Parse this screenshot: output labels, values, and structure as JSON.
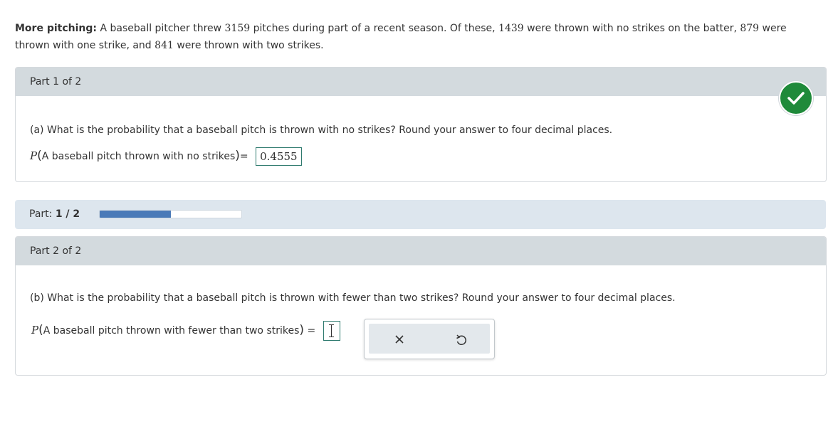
{
  "intro": {
    "label": "More pitching:",
    "text1": "A baseball pitcher threw",
    "total": "3159",
    "text2": "pitches during part of a recent season. Of these,",
    "no_strikes": "1439",
    "text3": "were thrown with no strikes on the batter,",
    "one_strike": "879",
    "text4": "were thrown with one strike, and",
    "two_strikes": "841",
    "text5": "were thrown with two strikes."
  },
  "part1": {
    "header": "Part 1 of 2",
    "question": "(a) What is the probability that a baseball pitch is thrown with no strikes? Round your answer to four decimal places.",
    "p_symbol": "P",
    "event": "A baseball pitch thrown with no strikes",
    "equals": "=",
    "answer": "0.4555",
    "status": "correct"
  },
  "progress": {
    "label": "Part:",
    "value": "1 / 2",
    "fraction": 0.5,
    "fill_color": "#4a7ab8"
  },
  "part2": {
    "header": "Part 2 of 2",
    "question": "(b) What is the probability that a baseball pitch is thrown with fewer than two strikes? Round your answer to four decimal places.",
    "p_symbol": "P",
    "event": "A baseball pitch thrown with fewer than two strikes",
    "equals": "=",
    "answer": ""
  },
  "toolbar": {
    "buttons": [
      "close-icon",
      "undo-icon"
    ]
  },
  "colors": {
    "check": "#1f8a3a",
    "header_bg": "#d3dade",
    "progress_bg": "#dde6ee"
  }
}
